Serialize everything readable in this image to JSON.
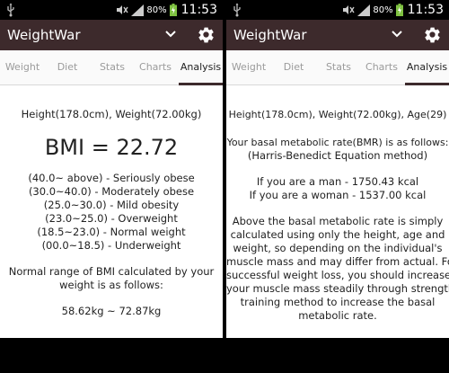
{
  "status": {
    "battery_pct": "80%",
    "time": "11:53"
  },
  "app": {
    "title": "WeightWar"
  },
  "tabs": [
    "Weight",
    "Diet",
    "Stats",
    "Charts",
    "Analysis"
  ],
  "left": {
    "measurements": "Height(178.0cm), Weight(72.00kg)",
    "bmi": "BMI = 22.72",
    "categories": [
      "(40.0~ above) - Seriously obese",
      "(30.0~40.0) - Moderately obese",
      "(25.0~30.0) - Mild obesity",
      "(23.0~25.0) - Overweight",
      "(18.5~23.0) - Normal weight",
      "(00.0~18.5) - Underweight"
    ],
    "normal_range_text": [
      "Normal range of BMI calculated by your",
      "weight is as follows:"
    ],
    "normal_range": "58.62kg ~ 72.87kg"
  },
  "right": {
    "measurements": "Height(178.0cm), Weight(72.00kg), Age(29)",
    "bmr_intro": [
      "Your basal metabolic rate(BMR) is as follows:",
      "(Harris-Benedict Equation method)"
    ],
    "bmr_man": "If you are a man - 1750.43 kcal",
    "bmr_woman": "If you are a woman - 1537.00 kcal",
    "explanation": [
      "Above the basal metabolic rate is simply",
      "calculated using only the height, age and",
      "weight, so depending on the individual's",
      "muscle mass and may differ from actual. For",
      "successful weight loss, you should increase",
      "your muscle mass steadily through strength",
      "training method to increase the basal",
      "metabolic rate."
    ]
  },
  "colors": {
    "app_bar": "#3d2a2c",
    "tab_active": "#222222",
    "tab_inactive": "#9b9b9b",
    "battery_charge": "#7fc241"
  },
  "icons": {
    "usb": "usb-icon",
    "mute": "mute-icon",
    "signal": "signal-icon",
    "battery": "battery-charging-icon",
    "dropdown": "chevron-down-icon",
    "settings": "gear-icon"
  }
}
